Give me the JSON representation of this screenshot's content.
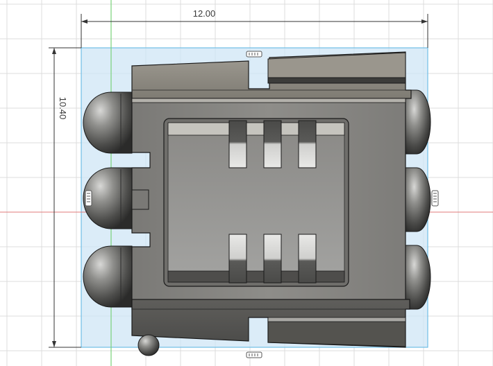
{
  "dimensions": {
    "width_value": "12.00",
    "height_value": "10.40"
  },
  "colors": {
    "background": "#ffffff",
    "grid_line": "#dcdcdc",
    "selection_fill": "#cfe6f5",
    "selection_outline": "#7ec3ea",
    "y_axis": "#79d279",
    "x_axis": "#e07a7a",
    "body_dark": "#6b6b67",
    "body_mid": "#8c8a84",
    "pocket": "#9a9a98",
    "outline": "#1a1a1a"
  },
  "view": {
    "sketch_constraint_icon": "constraint-glyph-icon"
  }
}
